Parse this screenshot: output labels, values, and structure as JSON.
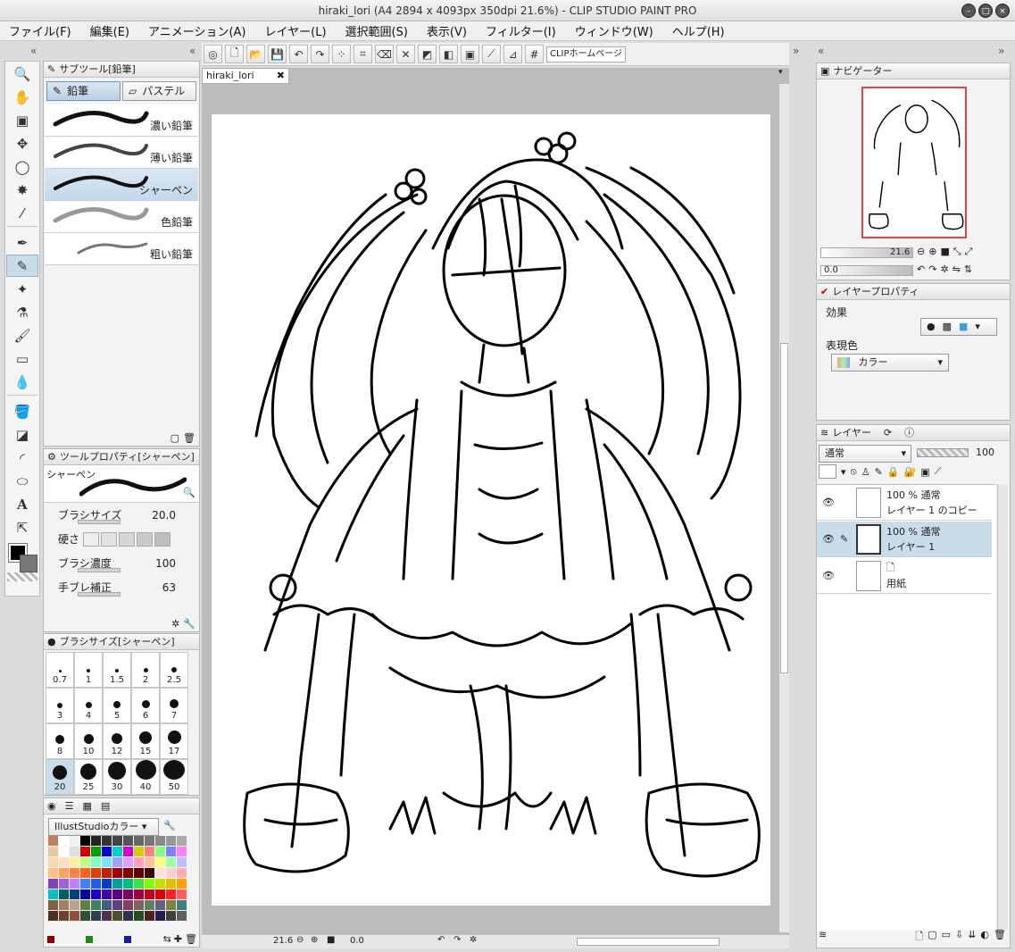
{
  "window": {
    "title": "hiraki_lori (A4 2894 x 4093px 350dpi 21.6%)  - CLIP STUDIO PAINT PRO"
  },
  "menu": [
    "ファイル(F)",
    "編集(E)",
    "アニメーション(A)",
    "レイヤー(L)",
    "選択範囲(S)",
    "表示(V)",
    "フィルター(I)",
    "ウィンドウ(W)",
    "ヘルプ(H)"
  ],
  "toolbar": {
    "clip_home": "CLIPホームページ"
  },
  "document": {
    "tab": "hiraki_lori",
    "zoom": "21.6",
    "angle": "0.0"
  },
  "subtool": {
    "title": "サブツール[鉛筆]",
    "groups": [
      "鉛筆",
      "パステル"
    ],
    "brushes": [
      {
        "label": "濃い鉛筆"
      },
      {
        "label": "薄い鉛筆"
      },
      {
        "label": "シャーペン"
      },
      {
        "label": "色鉛筆"
      },
      {
        "label": "粗い鉛筆"
      }
    ]
  },
  "toolprop": {
    "title": "ツールプロパティ[シャーペン]",
    "preview_label": "シャーペン",
    "brush_size_label": "ブラシサイズ",
    "brush_size": "20.0",
    "hardness_label": "硬さ",
    "density_label": "ブラシ濃度",
    "density": "100",
    "stabilization_label": "手ブレ補正",
    "stabilization": "63"
  },
  "brushsize": {
    "title": "ブラシサイズ[シャーペン]",
    "sizes": [
      "0.7",
      "1",
      "1.5",
      "2",
      "2.5",
      "3",
      "4",
      "5",
      "6",
      "7",
      "8",
      "10",
      "12",
      "15",
      "17",
      "20",
      "25",
      "30",
      "40",
      "50"
    ]
  },
  "colorset": {
    "set_name": "IllustStudioカラー"
  },
  "navigator": {
    "title": "ナビゲーター",
    "zoom": "21.6",
    "angle": "0.0"
  },
  "layerprop": {
    "title": "レイヤープロパティ",
    "effect_label": "効果",
    "expression_label": "表現色",
    "expression_value": "カラー"
  },
  "layers": {
    "title": "レイヤー",
    "blend": "通常",
    "opacity": "100",
    "items": [
      {
        "info": "100 % 通常",
        "name": "レイヤー 1 のコピー"
      },
      {
        "info": "100 % 通常",
        "name": "レイヤー 1"
      },
      {
        "info": "",
        "name": "用紙"
      }
    ]
  },
  "colors": {
    "accent_select": "#c9dcea",
    "nav_border": "#e04545"
  }
}
